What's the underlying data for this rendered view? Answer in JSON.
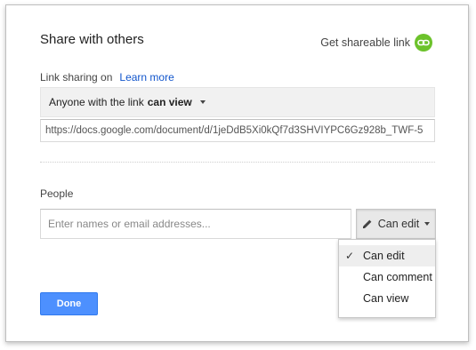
{
  "dialog": {
    "title": "Share with others",
    "get_link_label": "Get shareable link",
    "link_status": "Link sharing on",
    "learn_more": "Learn more",
    "access": {
      "prefix": "Anyone with the link",
      "permission": "can view"
    },
    "share_url": "https://docs.google.com/document/d/1jeDdB5Xi0kQf7d3SHVIYPC6Gz928b_TWF-5",
    "people_label": "People",
    "people_placeholder": "Enter names or email addresses...",
    "permission_button_label": "Can edit",
    "permission_menu": [
      {
        "label": "Can edit",
        "selected": true
      },
      {
        "label": "Can comment",
        "selected": false
      },
      {
        "label": "Can view",
        "selected": false
      }
    ],
    "check_glyph": "✓",
    "done_label": "Done"
  },
  "colors": {
    "link_icon": "#6cc22b",
    "learn_more": "#1155cc",
    "done_button": "#4d90fe"
  },
  "icons": {
    "link": "link-icon",
    "pencil": "pencil-icon",
    "check": "check-icon"
  }
}
